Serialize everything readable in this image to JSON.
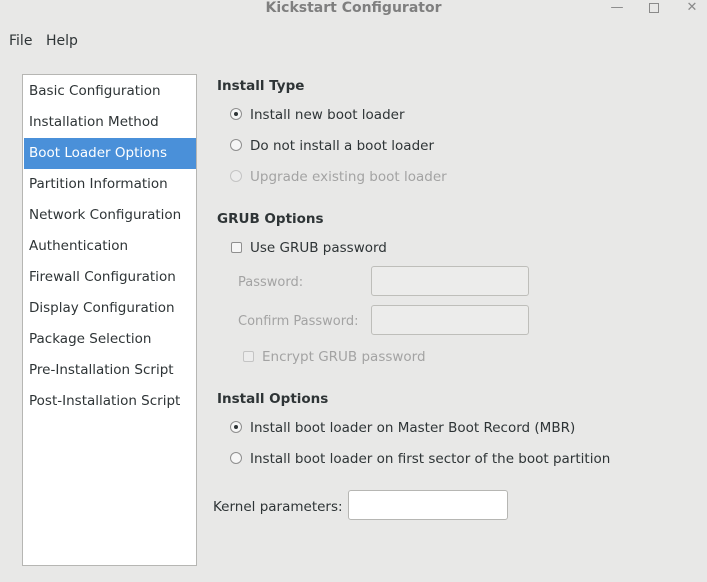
{
  "window": {
    "title": "Kickstart Configurator",
    "minimize_icon": "minimize-icon",
    "maximize_icon": "maximize-icon",
    "close_icon": "close-icon"
  },
  "menubar": {
    "file": "File",
    "help": "Help"
  },
  "sidebar": {
    "items": [
      {
        "label": "Basic Configuration"
      },
      {
        "label": "Installation Method"
      },
      {
        "label": "Boot Loader Options"
      },
      {
        "label": "Partition Information"
      },
      {
        "label": "Network Configuration"
      },
      {
        "label": "Authentication"
      },
      {
        "label": "Firewall Configuration"
      },
      {
        "label": "Display Configuration"
      },
      {
        "label": "Package Selection"
      },
      {
        "label": "Pre-Installation Script"
      },
      {
        "label": "Post-Installation Script"
      }
    ],
    "selected": "Boot Loader Options"
  },
  "install_type": {
    "heading": "Install Type",
    "options": [
      {
        "label": "Install new boot loader",
        "checked": true,
        "enabled": true
      },
      {
        "label": "Do not install a boot loader",
        "checked": false,
        "enabled": true
      },
      {
        "label": "Upgrade existing boot loader",
        "checked": false,
        "enabled": false
      }
    ]
  },
  "grub_options": {
    "heading": "GRUB Options",
    "use_password_label": "Use GRUB password",
    "use_password_checked": false,
    "password_label": "Password:",
    "password_value": "",
    "confirm_label": "Confirm Password:",
    "confirm_value": "",
    "encrypt_label": "Encrypt GRUB password",
    "encrypt_checked": false
  },
  "install_options": {
    "heading": "Install Options",
    "options": [
      {
        "label": "Install boot loader on Master Boot Record (MBR)",
        "checked": true
      },
      {
        "label": "Install boot loader on first sector of the boot partition",
        "checked": false
      }
    ]
  },
  "kernel": {
    "label": "Kernel parameters:",
    "value": ""
  }
}
